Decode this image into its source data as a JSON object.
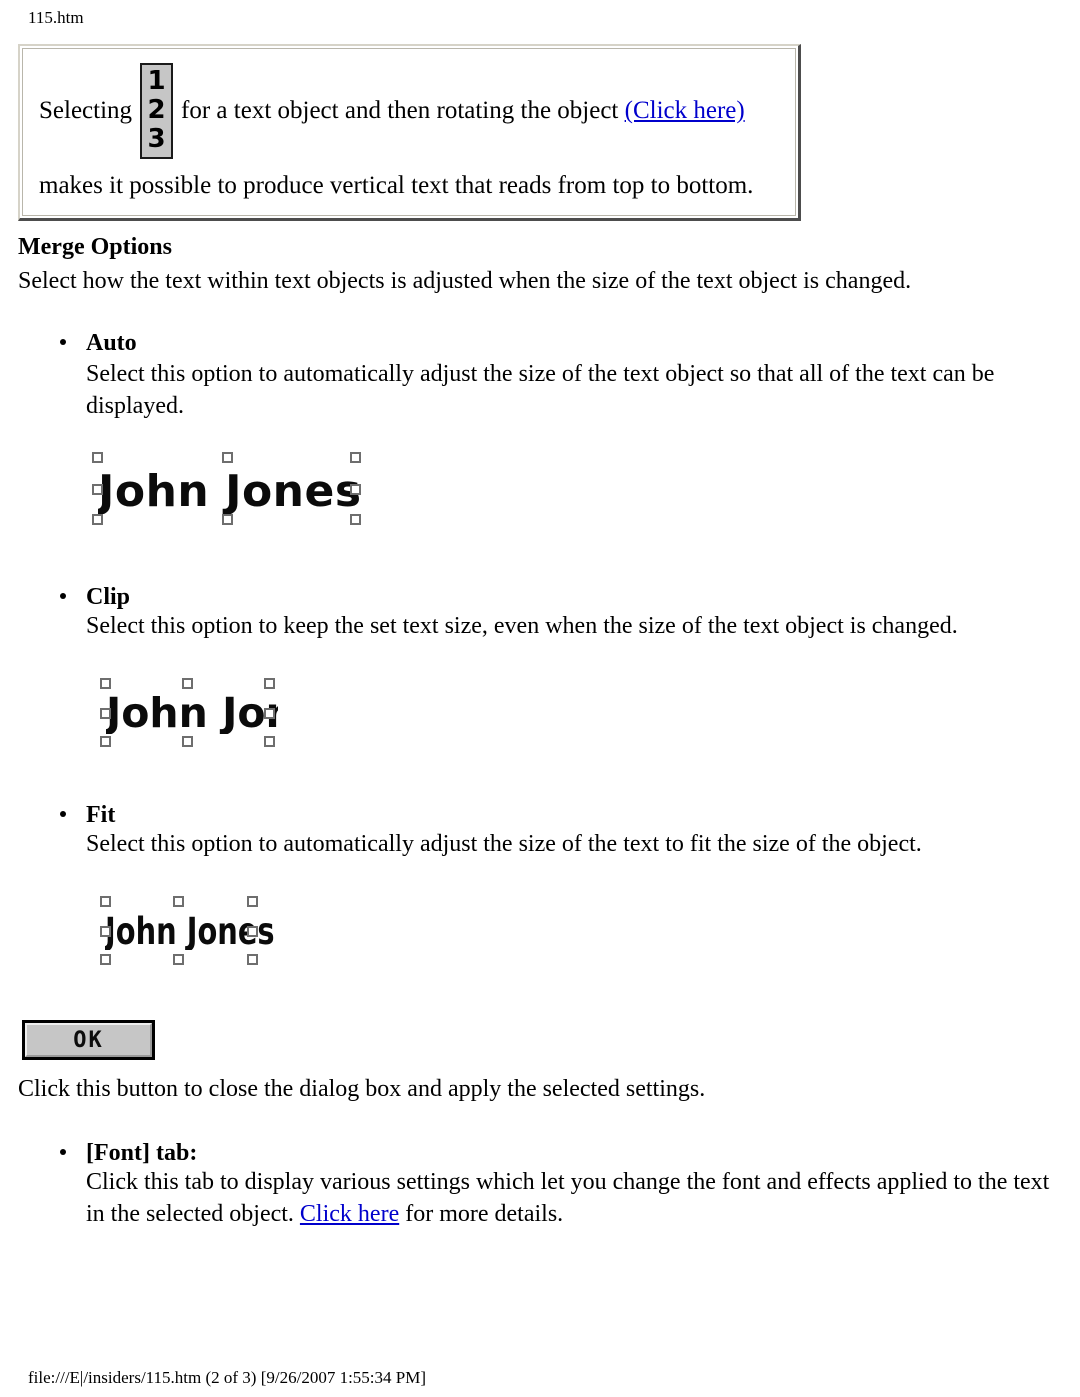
{
  "page": {
    "header_filename": "115.htm",
    "footer": "file:///E|/insiders/115.htm (2 of 3) [9/26/2007 1:55:34 PM]"
  },
  "callout": {
    "text_before_icon": "Selecting",
    "icon_digits": {
      "first": "1",
      "second": "2",
      "third": "3"
    },
    "text_after_icon": "for a text object and then rotating the object",
    "link_label": "(Click here)",
    "line_two": "makes it possible to produce vertical text that reads from top to bottom."
  },
  "section": {
    "heading": "Merge Options",
    "intro": "Select how the text within text objects is adjusted when the size of the text object is changed."
  },
  "options": {
    "auto": {
      "label": "Auto",
      "description": "Select this option to automatically adjust the size of the text object so that all of the text can be displayed.",
      "sample_text": "John Jones"
    },
    "clip": {
      "label": "Clip",
      "description": "Select this option to keep the set text size, even when the size of the text object is changed.",
      "sample_text": "John Jones"
    },
    "fit": {
      "label": "Fit",
      "description": "Select this option to automatically adjust the size of the text to fit the size of the object.",
      "sample_text": "John Jones"
    }
  },
  "ok_button": {
    "label": "OK",
    "description": "Click this button to close the dialog box and apply the selected settings."
  },
  "font_tab": {
    "label": "[Font] tab:",
    "description_part1": "Click this tab to display various settings which let you change the font and effects applied to the text in the selected object.",
    "link_label": "Click here",
    "description_part2": "for more details."
  },
  "colors": {
    "link": "#0000cc",
    "button_face": "#c6c6c6",
    "icon_face": "#c6c6c6",
    "callout_shadow": "#4d4d4d"
  }
}
